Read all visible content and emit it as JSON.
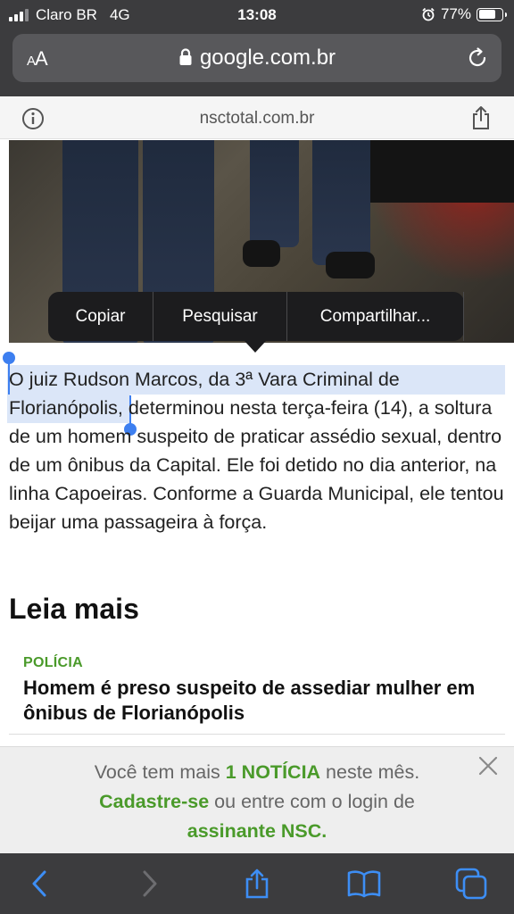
{
  "status_bar": {
    "carrier": "Claro BR",
    "network": "4G",
    "time": "13:08",
    "battery_text": "77%",
    "battery_level": 0.77
  },
  "browser": {
    "text_size_label_small": "A",
    "text_size_label_large": "A",
    "url": "google.com.br",
    "site_domain": "nsctotal.com.br"
  },
  "selection_menu": {
    "items": [
      "Copiar",
      "Pesquisar",
      "Compartilhar..."
    ]
  },
  "article": {
    "selected_text": "O juiz Rudson Marcos, da 3ª Vara Criminal de Florianópolis",
    "body_text": ", determinou nesta terça-feira (14), a soltura de um homem suspeito de praticar assédio sexual, dentro de um ônibus da Capital. Ele foi detido no dia anterior, na linha Capoeiras. Conforme a Guarda Municipal, ele tentou beijar uma passageira à força."
  },
  "related": {
    "heading": "Leia mais",
    "items": [
      {
        "category": "POLÍCIA",
        "title": "Homem é preso suspeito de assediar mulher em ônibus de Florianópolis"
      }
    ]
  },
  "paywall": {
    "line1_prefix": "Você tem mais ",
    "line1_highlight": "1 NOTÍCIA",
    "line1_suffix": " neste mês.",
    "line2_highlight": "Cadastre-se",
    "line2_suffix": " ou entre com o login de",
    "line3_highlight": "assinante NSC."
  },
  "colors": {
    "brand_green": "#4a9a2a",
    "selection_blue": "#3d7ff0",
    "selection_fill": "#dbe6f8",
    "toolbar_blue": "#3d8ef5"
  },
  "toolbar": {
    "icons": [
      "back-icon",
      "forward-icon",
      "share-icon",
      "bookmarks-icon",
      "tabs-icon"
    ]
  }
}
